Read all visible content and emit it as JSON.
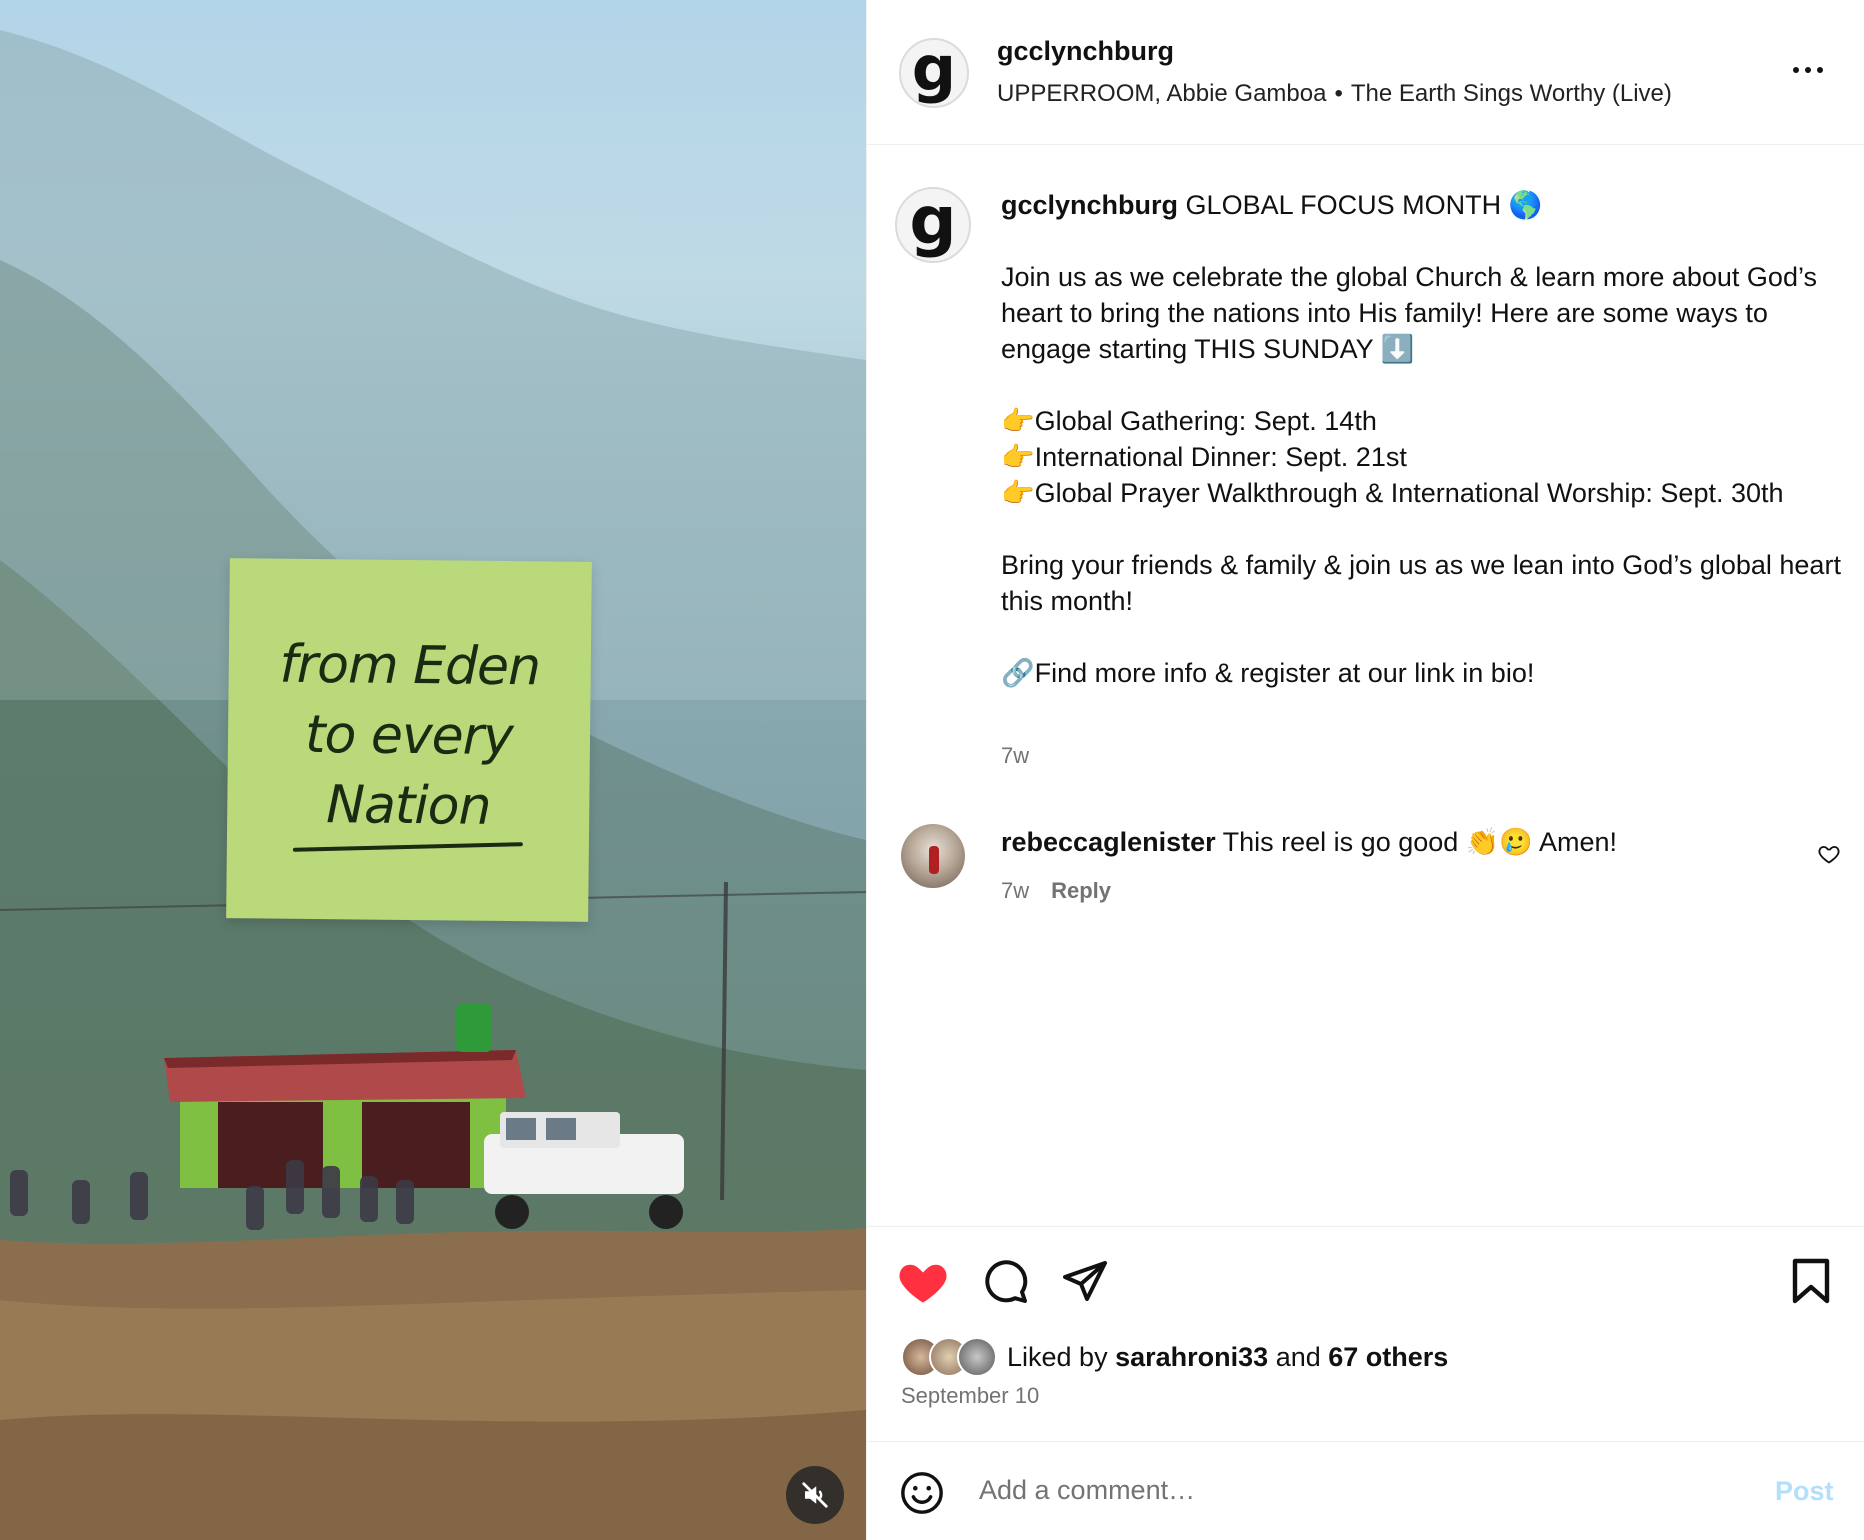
{
  "media": {
    "sticky_note": {
      "line1": "from Eden",
      "line2": "to every",
      "line3": "Nation"
    },
    "mute_icon": "speaker-muted-icon"
  },
  "header": {
    "avatar_letter": "g",
    "username": "gcclynchburg",
    "audio_artist": "UPPERROOM, Abbie Gamboa",
    "audio_separator": "•",
    "audio_title": "The Earth Sings Worthy (Live)",
    "more_icon": "more-options-icon"
  },
  "caption": {
    "avatar_letter": "g",
    "username": "gcclynchburg",
    "title": "GLOBAL FOCUS MONTH 🌎",
    "paragraph1": "Join us as we celebrate the global Church & learn more about God’s heart to bring the nations into His family! Here are some ways to engage starting THIS SUNDAY ⬇️",
    "item1": "👉Global Gathering: Sept. 14th",
    "item2": "👉International Dinner: Sept. 21st",
    "item3": "👉Global Prayer Walkthrough & International Worship: Sept. 30th",
    "paragraph3": "Bring your friends & family & join us as we lean into God’s global heart this month!",
    "paragraph4": "🔗Find more info & register at our link in bio!",
    "time": "7w"
  },
  "comment": {
    "username": "rebeccaglenister",
    "text": "This reel is go good 👏🥲 Amen!",
    "time": "7w",
    "reply_label": "Reply",
    "like_icon": "heart-outline-icon"
  },
  "actions": {
    "like_icon": "heart-filled-icon",
    "comment_icon": "comment-bubble-icon",
    "share_icon": "paper-plane-icon",
    "save_icon": "bookmark-icon",
    "like_color": "#ff3040",
    "liked_by_prefix": "Liked by",
    "liked_by_user": "sarahroni33",
    "liked_by_and": "and",
    "liked_by_others": "67 others",
    "date": "September 10"
  },
  "comment_box": {
    "emoji_icon": "smiley-icon",
    "placeholder": "Add a comment…",
    "post_label": "Post",
    "post_color": "#b2dffc"
  }
}
